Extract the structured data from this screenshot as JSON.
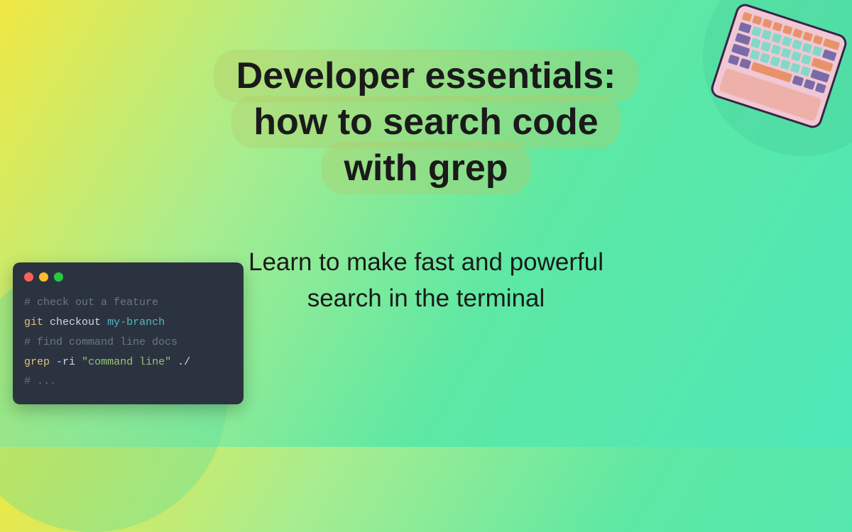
{
  "title_line1": "Developer essentials:",
  "title_line2": "how to search code",
  "title_line3": "with grep",
  "subtitle": "Learn to make fast and powerful search in the terminal",
  "terminal": {
    "line1_comment": "# check out a feature",
    "line2_cmd": "git",
    "line2_sub": "checkout",
    "line2_arg": "my-branch",
    "line3_comment": "# find command line docs",
    "line4_cmd": "grep",
    "line4_flags": "-ri",
    "line4_string": "\"command line\"",
    "line4_path": "./",
    "line5_comment": "# ..."
  },
  "icons": {
    "keyboard": "keyboard-icon",
    "terminal": "terminal-window-icon"
  }
}
